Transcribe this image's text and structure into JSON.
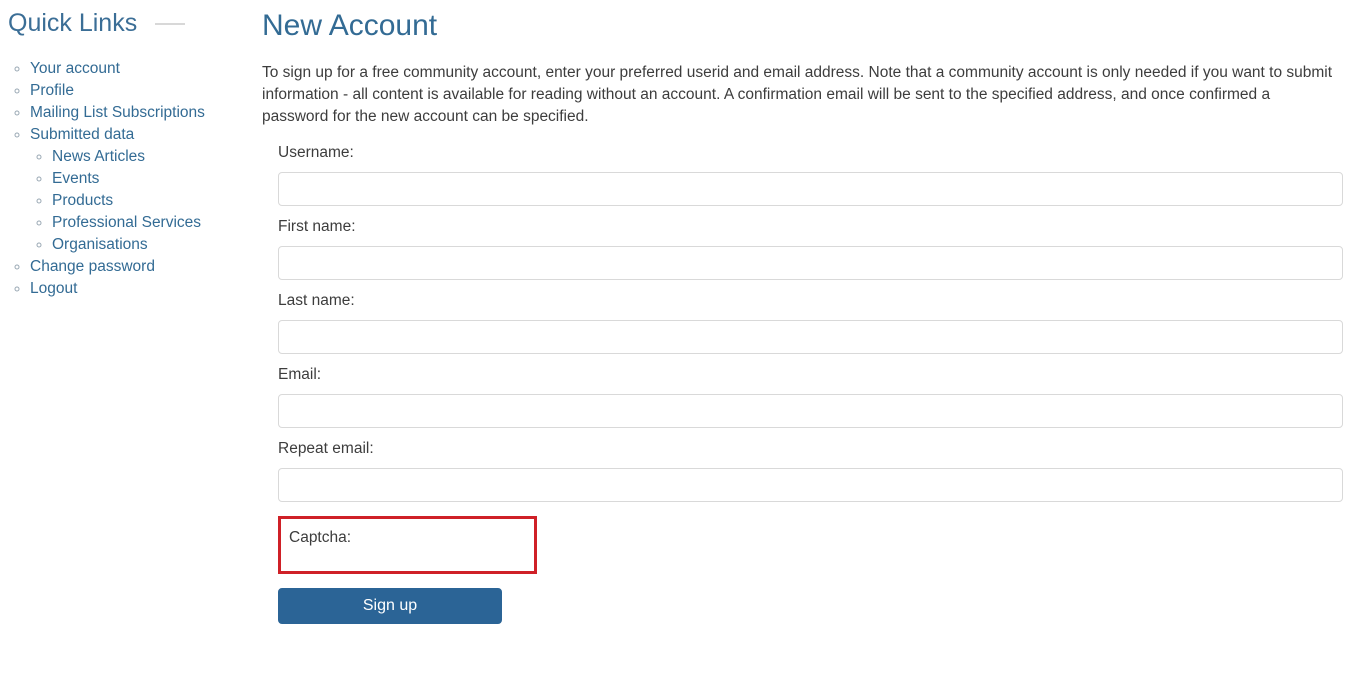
{
  "sidebar": {
    "title": "Quick Links",
    "rule": "horizontal-rule",
    "items": [
      {
        "label": "Your account",
        "name": "your-account"
      },
      {
        "label": "Profile",
        "name": "profile"
      },
      {
        "label": "Mailing List Subscriptions",
        "name": "mailing-list-subscriptions"
      },
      {
        "label": "Submitted data",
        "name": "submitted-data",
        "children": [
          {
            "label": "News Articles",
            "name": "news-articles"
          },
          {
            "label": "Events",
            "name": "events"
          },
          {
            "label": "Products",
            "name": "products"
          },
          {
            "label": "Professional Services",
            "name": "professional-services"
          },
          {
            "label": "Organisations",
            "name": "organisations"
          }
        ]
      },
      {
        "label": "Change password",
        "name": "change-password"
      },
      {
        "label": "Logout",
        "name": "logout"
      }
    ]
  },
  "main": {
    "title": "New Account",
    "intro": "To sign up for a free community account, enter your preferred userid and email address. Note that a community account is only needed if you want to submit information - all content is available for reading without an account. A confirmation email will be sent to the specified address, and once confirmed a password for the new account can be specified.",
    "form": {
      "fields": [
        {
          "label": "Username:",
          "value": "",
          "placeholder": "",
          "name": "username"
        },
        {
          "label": "First name:",
          "value": "",
          "placeholder": "",
          "name": "first-name"
        },
        {
          "label": "Last name:",
          "value": "",
          "placeholder": "",
          "name": "last-name"
        },
        {
          "label": "Email:",
          "value": "",
          "placeholder": "",
          "name": "email"
        },
        {
          "label": "Repeat email:",
          "value": "",
          "placeholder": "",
          "name": "repeat-email"
        }
      ],
      "captcha_label": "Captcha:",
      "submit_label": "Sign up"
    }
  },
  "colors": {
    "link": "#336b94",
    "heading": "#336b94",
    "button": "#2b6496",
    "highlight": "#cf2027",
    "input_border": "#d9d9d9",
    "body_text": "#3d3d3d"
  }
}
